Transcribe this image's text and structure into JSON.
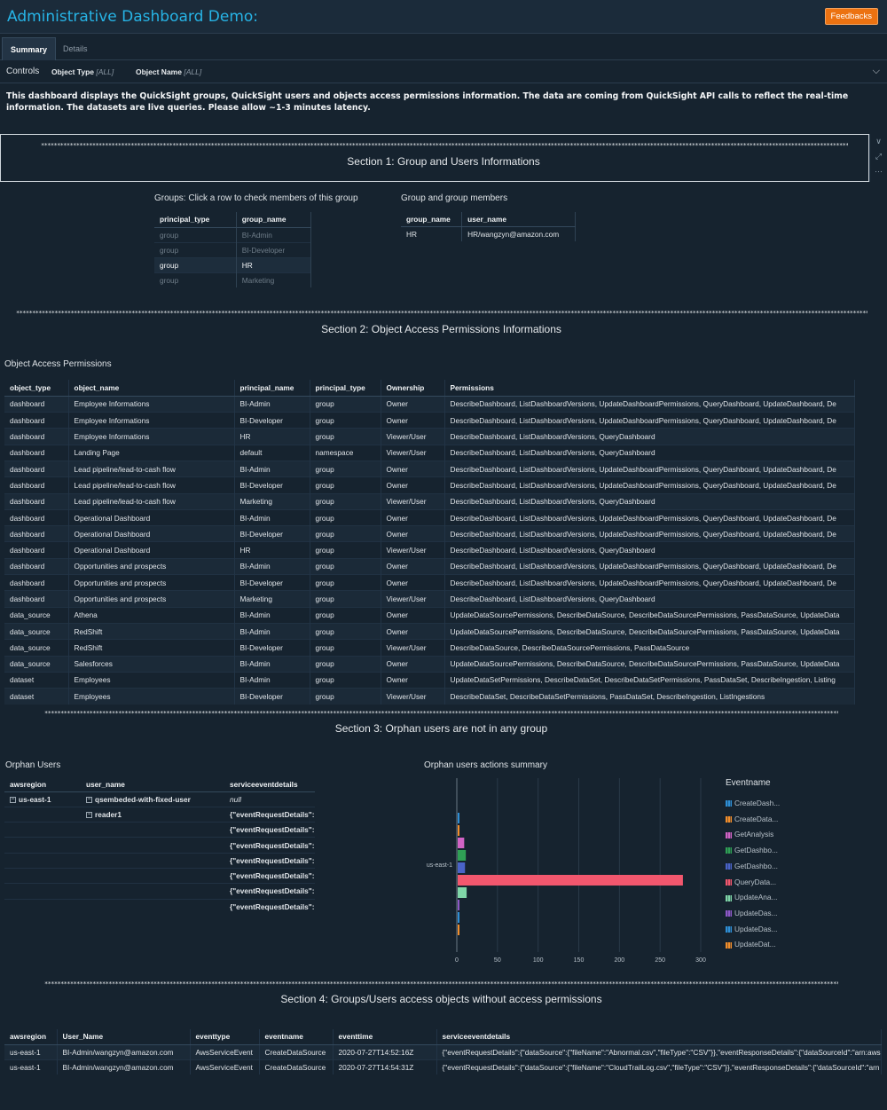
{
  "app": {
    "title": "Administrative Dashboard Demo:",
    "feedback_label": "Feedbacks"
  },
  "tabs": [
    {
      "label": "Summary",
      "active": true
    },
    {
      "label": "Details",
      "active": false
    }
  ],
  "controls": {
    "label": "Controls",
    "object_type": {
      "label": "Object Type",
      "value": "[ALL]"
    },
    "object_name": {
      "label": "Object Name",
      "value": "[ALL]"
    }
  },
  "description": "This dashboard displays the QuickSight groups, QuickSight users and objects access permissions information. The data are coming from QuickSight API calls to reflect the real-time information. The datasets are live queries. Please allow ~1-3 minutes latency.",
  "separator": "**************************************************************************************************************************************************************************************************************************************************************************",
  "section1": {
    "title": "Section 1: Group and Users Informations",
    "groups": {
      "title": "Groups: Click a row to check members of this group",
      "columns": [
        "principal_type",
        "group_name"
      ],
      "rows": [
        [
          "group",
          "BI-Admin"
        ],
        [
          "group",
          "BI-Developer"
        ],
        [
          "group",
          "HR"
        ],
        [
          "group",
          "Marketing"
        ]
      ],
      "selected_index": 2
    },
    "members": {
      "title": "Group and group members",
      "columns": [
        "group_name",
        "user_name"
      ],
      "rows": [
        [
          "HR",
          "HR/wangzyn@amazon.com"
        ]
      ]
    }
  },
  "section2": {
    "title": "Section 2: Object Access Permissions Informations",
    "table_title": "Object Access Permissions",
    "columns": [
      "object_type",
      "object_name",
      "principal_name",
      "principal_type",
      "Ownership",
      "Permissions"
    ],
    "rows": [
      [
        "dashboard",
        "Employee Informations",
        "BI-Admin",
        "group",
        "Owner",
        "DescribeDashboard, ListDashboardVersions, UpdateDashboardPermissions, QueryDashboard, UpdateDashboard, De"
      ],
      [
        "dashboard",
        "Employee Informations",
        "BI-Developer",
        "group",
        "Owner",
        "DescribeDashboard, ListDashboardVersions, UpdateDashboardPermissions, QueryDashboard, UpdateDashboard, De"
      ],
      [
        "dashboard",
        "Employee Informations",
        "HR",
        "group",
        "Viewer/User",
        "DescribeDashboard, ListDashboardVersions, QueryDashboard"
      ],
      [
        "dashboard",
        "Landing Page",
        "default",
        "namespace",
        "Viewer/User",
        "DescribeDashboard, ListDashboardVersions, QueryDashboard"
      ],
      [
        "dashboard",
        "Lead pipeline/lead-to-cash flow",
        "BI-Admin",
        "group",
        "Owner",
        "DescribeDashboard, ListDashboardVersions, UpdateDashboardPermissions, QueryDashboard, UpdateDashboard, De"
      ],
      [
        "dashboard",
        "Lead pipeline/lead-to-cash flow",
        "BI-Developer",
        "group",
        "Owner",
        "DescribeDashboard, ListDashboardVersions, UpdateDashboardPermissions, QueryDashboard, UpdateDashboard, De"
      ],
      [
        "dashboard",
        "Lead pipeline/lead-to-cash flow",
        "Marketing",
        "group",
        "Viewer/User",
        "DescribeDashboard, ListDashboardVersions, QueryDashboard"
      ],
      [
        "dashboard",
        "Operational Dashboard",
        "BI-Admin",
        "group",
        "Owner",
        "DescribeDashboard, ListDashboardVersions, UpdateDashboardPermissions, QueryDashboard, UpdateDashboard, De"
      ],
      [
        "dashboard",
        "Operational Dashboard",
        "BI-Developer",
        "group",
        "Owner",
        "DescribeDashboard, ListDashboardVersions, UpdateDashboardPermissions, QueryDashboard, UpdateDashboard, De"
      ],
      [
        "dashboard",
        "Operational Dashboard",
        "HR",
        "group",
        "Viewer/User",
        "DescribeDashboard, ListDashboardVersions, QueryDashboard"
      ],
      [
        "dashboard",
        "Opportunities and prospects",
        "BI-Admin",
        "group",
        "Owner",
        "DescribeDashboard, ListDashboardVersions, UpdateDashboardPermissions, QueryDashboard, UpdateDashboard, De"
      ],
      [
        "dashboard",
        "Opportunities and prospects",
        "BI-Developer",
        "group",
        "Owner",
        "DescribeDashboard, ListDashboardVersions, UpdateDashboardPermissions, QueryDashboard, UpdateDashboard, De"
      ],
      [
        "dashboard",
        "Opportunities and prospects",
        "Marketing",
        "group",
        "Viewer/User",
        "DescribeDashboard, ListDashboardVersions, QueryDashboard"
      ],
      [
        "data_source",
        "Athena",
        "BI-Admin",
        "group",
        "Owner",
        "UpdateDataSourcePermissions, DescribeDataSource, DescribeDataSourcePermissions, PassDataSource, UpdateData"
      ],
      [
        "data_source",
        "RedShift",
        "BI-Admin",
        "group",
        "Owner",
        "UpdateDataSourcePermissions, DescribeDataSource, DescribeDataSourcePermissions, PassDataSource, UpdateData"
      ],
      [
        "data_source",
        "RedShift",
        "BI-Developer",
        "group",
        "Viewer/User",
        "DescribeDataSource, DescribeDataSourcePermissions, PassDataSource"
      ],
      [
        "data_source",
        "Salesforces",
        "BI-Admin",
        "group",
        "Owner",
        "UpdateDataSourcePermissions, DescribeDataSource, DescribeDataSourcePermissions, PassDataSource, UpdateData"
      ],
      [
        "dataset",
        "Employees",
        "BI-Admin",
        "group",
        "Owner",
        "UpdateDataSetPermissions, DescribeDataSet, DescribeDataSetPermissions, PassDataSet, DescribeIngestion, Listing"
      ],
      [
        "dataset",
        "Employees",
        "BI-Developer",
        "group",
        "Viewer/User",
        "DescribeDataSet, DescribeDataSetPermissions, PassDataSet, DescribeIngestion, ListIngestions"
      ]
    ]
  },
  "section3": {
    "title": "Section 3:  Orphan users are not in any group",
    "orphan_users": {
      "title": "Orphan Users",
      "columns": [
        "awsregion",
        "user_name",
        "serviceeventdetails"
      ],
      "region": "us-east-1",
      "user1": "qsembeded-with-fixed-user",
      "user1_detail": "null",
      "user2": "reader1",
      "user2_details": [
        "{\"eventRequestDetails\":",
        "{\"eventRequestDetails\":",
        "{\"eventRequestDetails\":",
        "{\"eventRequestDetails\":",
        "{\"eventRequestDetails\":",
        "{\"eventRequestDetails\":",
        "{\"eventRequestDetails\":"
      ]
    },
    "chart_title": "Orphan users actions summary",
    "legend_title": "Eventname"
  },
  "chart_data": {
    "type": "bar",
    "orientation": "horizontal",
    "categories": [
      "us-east-1"
    ],
    "series": [
      {
        "name": "CreateDash...",
        "values": [
          1
        ],
        "color": "#2e8fd6"
      },
      {
        "name": "CreateData...",
        "values": [
          1
        ],
        "color": "#f28e2b"
      },
      {
        "name": "GetAnalysis",
        "values": [
          8
        ],
        "color": "#d163c5"
      },
      {
        "name": "GetDashbo...",
        "values": [
          10
        ],
        "color": "#2fa055"
      },
      {
        "name": "GetDashbo...",
        "values": [
          9
        ],
        "color": "#4a63c8"
      },
      {
        "name": "QueryData...",
        "values": [
          277
        ],
        "color": "#f2576e"
      },
      {
        "name": "UpdateAna...",
        "values": [
          11
        ],
        "color": "#7fd6a8"
      },
      {
        "name": "UpdateDas...",
        "values": [
          1
        ],
        "color": "#8e58c8"
      },
      {
        "name": "UpdateDas...",
        "values": [
          1
        ],
        "color": "#2e8fd6"
      },
      {
        "name": "UpdateDat...",
        "values": [
          2
        ],
        "color": "#f28e2b"
      }
    ],
    "xlim": [
      0,
      300
    ],
    "xticks": [
      0,
      50,
      100,
      150,
      200,
      250,
      300
    ],
    "grid": true,
    "legend_position": "right"
  },
  "section4": {
    "title": "Section 4:  Groups/Users access objects without access permissions",
    "columns": [
      "awsregion",
      "User_Name",
      "eventtype",
      "eventname",
      "eventtime",
      "serviceeventdetails"
    ],
    "rows": [
      [
        "us-east-1",
        "BI-Admin/wangzyn@amazon.com",
        "AwsServiceEvent",
        "CreateDataSource",
        "2020-07-27T14:52:16Z",
        "{\"eventRequestDetails\":{\"dataSource\":{\"fileName\":\"Abnormal.csv\",\"fileType\":\"CSV\"}},\"eventResponseDetails\":{\"dataSourceId\":\"arn:aws"
      ],
      [
        "us-east-1",
        "BI-Admin/wangzyn@amazon.com",
        "AwsServiceEvent",
        "CreateDataSource",
        "2020-07-27T14:54:31Z",
        "{\"eventRequestDetails\":{\"dataSource\":{\"fileName\":\"CloudTrailLog.csv\",\"fileType\":\"CSV\"}},\"eventResponseDetails\":{\"dataSourceId\":\"arn"
      ]
    ]
  }
}
